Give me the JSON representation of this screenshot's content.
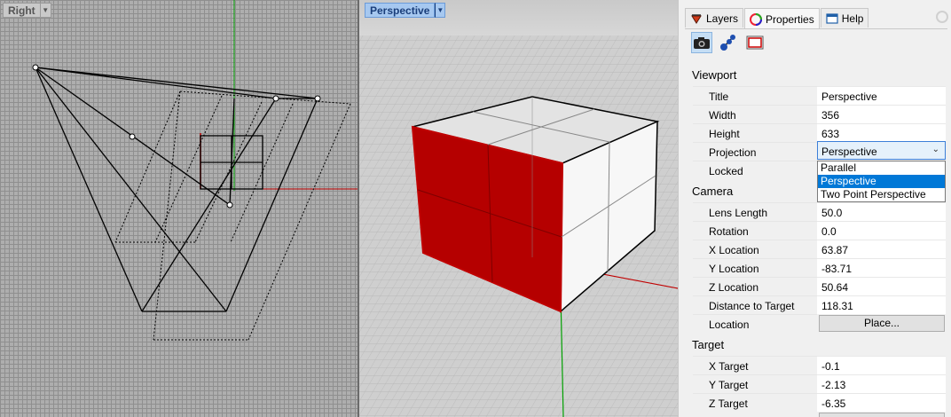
{
  "viewports": {
    "right": {
      "title": "Right",
      "menu_arrow": "▼"
    },
    "perspective": {
      "title": "Perspective",
      "menu_arrow": "▼"
    }
  },
  "panel": {
    "tabs": [
      {
        "label": "Layers",
        "icon": "layers-icon"
      },
      {
        "label": "Properties",
        "icon": "properties-icon"
      },
      {
        "label": "Help",
        "icon": "help-icon"
      }
    ],
    "icon_bar": [
      "camera-icon",
      "nodes-icon",
      "frame-icon"
    ],
    "sections": {
      "viewport": "Viewport",
      "camera": "Camera",
      "target": "Target"
    },
    "viewport": {
      "title_label": "Title",
      "title_value": "Perspective",
      "width_label": "Width",
      "width_value": "356",
      "height_label": "Height",
      "height_value": "633",
      "projection_label": "Projection",
      "projection_value": "Perspective",
      "locked_label": "Locked"
    },
    "projection_options": [
      "Parallel",
      "Perspective",
      "Two Point Perspective"
    ],
    "camera": {
      "lens_label": "Lens Length",
      "lens_value": "50.0",
      "rotation_label": "Rotation",
      "rotation_value": "0.0",
      "xloc_label": "X Location",
      "xloc_value": "63.87",
      "yloc_label": "Y Location",
      "yloc_value": "-83.71",
      "zloc_label": "Z Location",
      "zloc_value": "50.64",
      "dist_label": "Distance to Target",
      "dist_value": "118.31",
      "location_label": "Location",
      "place_button": "Place..."
    },
    "target": {
      "x_label": "X Target",
      "x_value": "-0.1",
      "y_label": "Y Target",
      "y_value": "-2.13",
      "z_label": "Z Target",
      "z_value": "-6.35"
    }
  },
  "colors": {
    "accent": "#0078d7",
    "selection_red": "#c00000",
    "axis_green": "#00a000"
  }
}
